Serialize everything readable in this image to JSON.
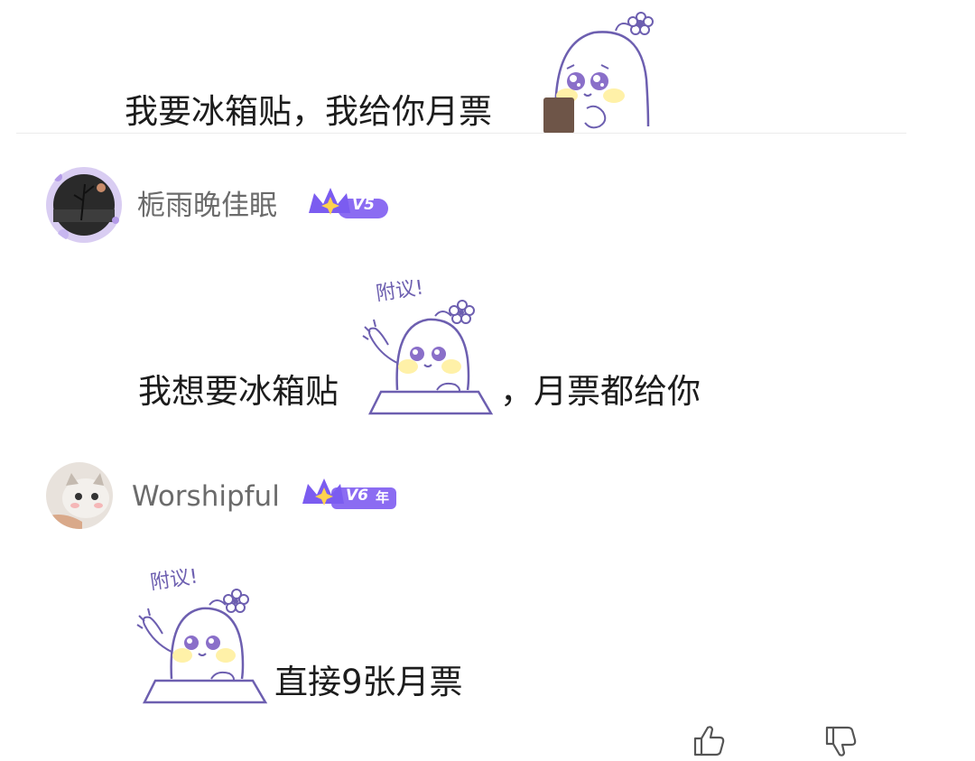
{
  "comment_1": {
    "text": "我要冰箱贴，我给你月票"
  },
  "comment_2": {
    "author": "栀雨晚佳眠",
    "level_badge": "V5",
    "text_before": "我想要冰箱贴",
    "sticker_caption": "附议!",
    "text_after": "，月票都给你"
  },
  "comment_3": {
    "author": "Worshipful",
    "level_badge": "V6",
    "year_badge": "年",
    "sticker_caption": "附议!",
    "text": "直接9张月票"
  },
  "actions": {
    "like_icon": "thumbs-up-icon",
    "dislike_icon": "thumbs-down-icon"
  },
  "colors": {
    "badge_purple": "#7b5cf0",
    "sticker_line": "#6d5fb0",
    "text": "#1c1c1c",
    "name": "#6b6b6b"
  }
}
